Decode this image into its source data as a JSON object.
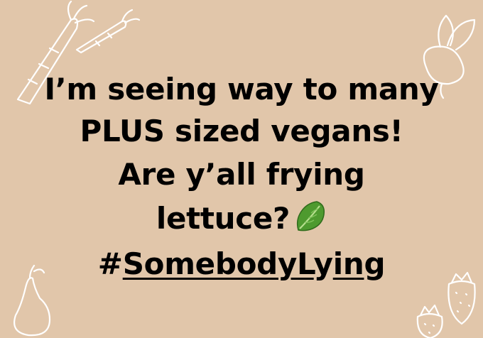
{
  "post": {
    "line1": "I’m seeing way to many",
    "line2": "PLUS sized vegans!",
    "line3": "Are y’all frying",
    "line4": "lettuce?",
    "hashtag_hash": "#",
    "hashtag_parts": [
      "Somebody",
      "L",
      "y",
      "in",
      "g"
    ]
  },
  "emoji": "leafy-green-icon",
  "colors": {
    "background": "#e1c6aa",
    "text": "#000000",
    "doodle": "#ffffff",
    "lettuce": "#4e9a2f"
  }
}
